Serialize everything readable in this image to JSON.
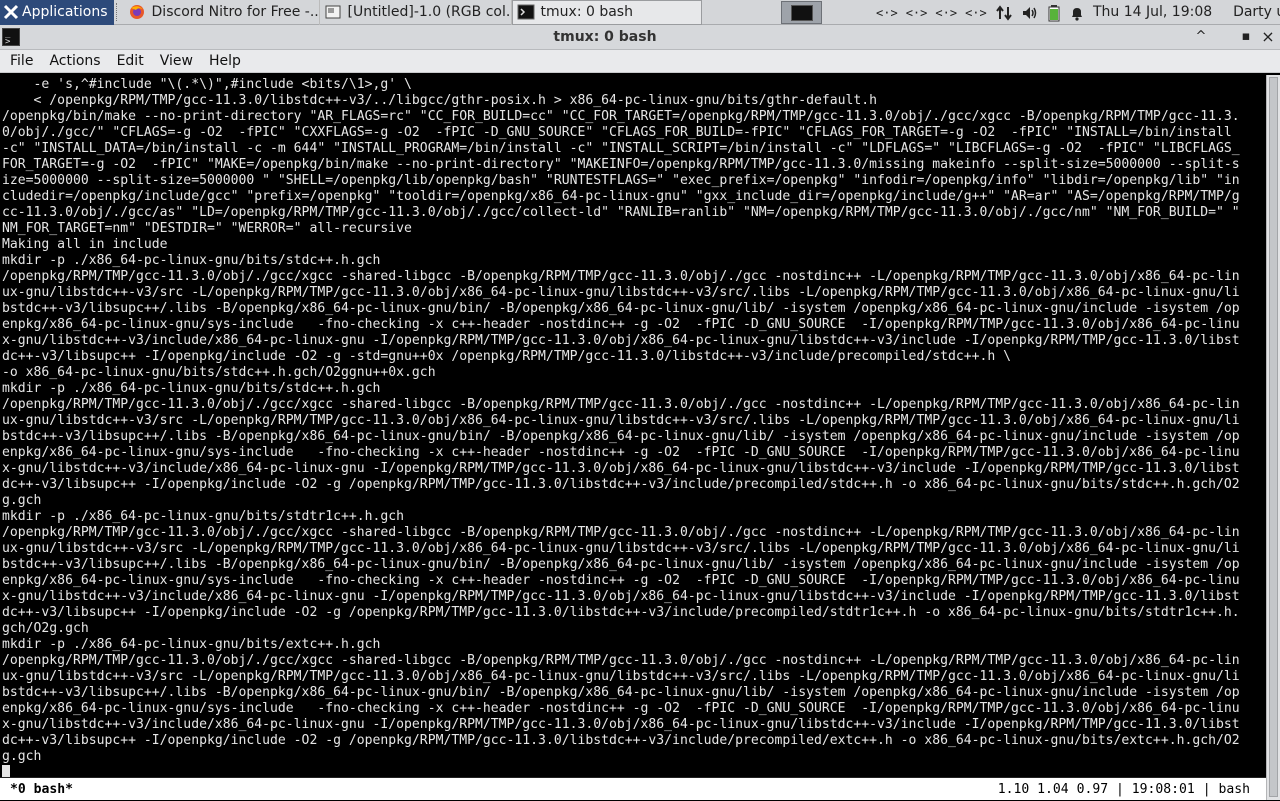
{
  "panel": {
    "applications_label": "Applications",
    "tasks": [
      {
        "label": "Discord Nitro for Free -...",
        "icon": "firefox-icon"
      },
      {
        "label": "[Untitled]-1.0 (RGB col...",
        "icon": "gimp-icon"
      },
      {
        "label": "tmux: 0 bash",
        "icon": "terminal-icon"
      }
    ],
    "tray_icons": [
      "network-icon",
      "network-icon",
      "network-icon",
      "network-icon",
      "transfer-icon",
      "volume-icon",
      "battery-icon",
      "bell-icon"
    ],
    "clock": "Thu 14 Jul, 19:08",
    "user": "Darty uwu"
  },
  "window": {
    "title": "tmux: 0 bash",
    "controls": {
      "minimize": "^",
      "maximize": "▪",
      "close": "×"
    }
  },
  "menubar": {
    "items": [
      "File",
      "Actions",
      "Edit",
      "View",
      "Help"
    ]
  },
  "terminal": {
    "lines": [
      "    -e 's,^#include \"\\(.*\\)\",#include <bits/\\1>,g' \\",
      "    < /openpkg/RPM/TMP/gcc-11.3.0/libstdc++-v3/../libgcc/gthr-posix.h > x86_64-pc-linux-gnu/bits/gthr-default.h",
      "/openpkg/bin/make --no-print-directory \"AR_FLAGS=rc\" \"CC_FOR_BUILD=cc\" \"CC_FOR_TARGET=/openpkg/RPM/TMP/gcc-11.3.0/obj/./gcc/xgcc -B/openpkg/RPM/TMP/gcc-11.3.",
      "0/obj/./gcc/\" \"CFLAGS=-g -O2  -fPIC\" \"CXXFLAGS=-g -O2  -fPIC -D_GNU_SOURCE\" \"CFLAGS_FOR_BUILD=-fPIC\" \"CFLAGS_FOR_TARGET=-g -O2  -fPIC\" \"INSTALL=/bin/install",
      "-c\" \"INSTALL_DATA=/bin/install -c -m 644\" \"INSTALL_PROGRAM=/bin/install -c\" \"INSTALL_SCRIPT=/bin/install -c\" \"LDFLAGS=\" \"LIBCFLAGS=-g -O2  -fPIC\" \"LIBCFLAGS_",
      "FOR_TARGET=-g -O2  -fPIC\" \"MAKE=/openpkg/bin/make --no-print-directory\" \"MAKEINFO=/openpkg/RPM/TMP/gcc-11.3.0/missing makeinfo --split-size=5000000 --split-s",
      "ize=5000000 --split-size=5000000 \" \"SHELL=/openpkg/lib/openpkg/bash\" \"RUNTESTFLAGS=\" \"exec_prefix=/openpkg\" \"infodir=/openpkg/info\" \"libdir=/openpkg/lib\" \"in",
      "cludedir=/openpkg/include/gcc\" \"prefix=/openpkg\" \"tooldir=/openpkg/x86_64-pc-linux-gnu\" \"gxx_include_dir=/openpkg/include/g++\" \"AR=ar\" \"AS=/openpkg/RPM/TMP/g",
      "cc-11.3.0/obj/./gcc/as\" \"LD=/openpkg/RPM/TMP/gcc-11.3.0/obj/./gcc/collect-ld\" \"RANLIB=ranlib\" \"NM=/openpkg/RPM/TMP/gcc-11.3.0/obj/./gcc/nm\" \"NM_FOR_BUILD=\" \"",
      "NM_FOR_TARGET=nm\" \"DESTDIR=\" \"WERROR=\" all-recursive",
      "Making all in include",
      "mkdir -p ./x86_64-pc-linux-gnu/bits/stdc++.h.gch",
      "/openpkg/RPM/TMP/gcc-11.3.0/obj/./gcc/xgcc -shared-libgcc -B/openpkg/RPM/TMP/gcc-11.3.0/obj/./gcc -nostdinc++ -L/openpkg/RPM/TMP/gcc-11.3.0/obj/x86_64-pc-lin",
      "ux-gnu/libstdc++-v3/src -L/openpkg/RPM/TMP/gcc-11.3.0/obj/x86_64-pc-linux-gnu/libstdc++-v3/src/.libs -L/openpkg/RPM/TMP/gcc-11.3.0/obj/x86_64-pc-linux-gnu/li",
      "bstdc++-v3/libsupc++/.libs -B/openpkg/x86_64-pc-linux-gnu/bin/ -B/openpkg/x86_64-pc-linux-gnu/lib/ -isystem /openpkg/x86_64-pc-linux-gnu/include -isystem /op",
      "enpkg/x86_64-pc-linux-gnu/sys-include   -fno-checking -x c++-header -nostdinc++ -g -O2  -fPIC -D_GNU_SOURCE  -I/openpkg/RPM/TMP/gcc-11.3.0/obj/x86_64-pc-linu",
      "x-gnu/libstdc++-v3/include/x86_64-pc-linux-gnu -I/openpkg/RPM/TMP/gcc-11.3.0/obj/x86_64-pc-linux-gnu/libstdc++-v3/include -I/openpkg/RPM/TMP/gcc-11.3.0/libst",
      "dc++-v3/libsupc++ -I/openpkg/include -O2 -g -std=gnu++0x /openpkg/RPM/TMP/gcc-11.3.0/libstdc++-v3/include/precompiled/stdc++.h \\",
      "-o x86_64-pc-linux-gnu/bits/stdc++.h.gch/O2ggnu++0x.gch",
      "mkdir -p ./x86_64-pc-linux-gnu/bits/stdc++.h.gch",
      "/openpkg/RPM/TMP/gcc-11.3.0/obj/./gcc/xgcc -shared-libgcc -B/openpkg/RPM/TMP/gcc-11.3.0/obj/./gcc -nostdinc++ -L/openpkg/RPM/TMP/gcc-11.3.0/obj/x86_64-pc-lin",
      "ux-gnu/libstdc++-v3/src -L/openpkg/RPM/TMP/gcc-11.3.0/obj/x86_64-pc-linux-gnu/libstdc++-v3/src/.libs -L/openpkg/RPM/TMP/gcc-11.3.0/obj/x86_64-pc-linux-gnu/li",
      "bstdc++-v3/libsupc++/.libs -B/openpkg/x86_64-pc-linux-gnu/bin/ -B/openpkg/x86_64-pc-linux-gnu/lib/ -isystem /openpkg/x86_64-pc-linux-gnu/include -isystem /op",
      "enpkg/x86_64-pc-linux-gnu/sys-include   -fno-checking -x c++-header -nostdinc++ -g -O2  -fPIC -D_GNU_SOURCE  -I/openpkg/RPM/TMP/gcc-11.3.0/obj/x86_64-pc-linu",
      "x-gnu/libstdc++-v3/include/x86_64-pc-linux-gnu -I/openpkg/RPM/TMP/gcc-11.3.0/obj/x86_64-pc-linux-gnu/libstdc++-v3/include -I/openpkg/RPM/TMP/gcc-11.3.0/libst",
      "dc++-v3/libsupc++ -I/openpkg/include -O2 -g /openpkg/RPM/TMP/gcc-11.3.0/libstdc++-v3/include/precompiled/stdc++.h -o x86_64-pc-linux-gnu/bits/stdc++.h.gch/O2",
      "g.gch",
      "mkdir -p ./x86_64-pc-linux-gnu/bits/stdtr1c++.h.gch",
      "/openpkg/RPM/TMP/gcc-11.3.0/obj/./gcc/xgcc -shared-libgcc -B/openpkg/RPM/TMP/gcc-11.3.0/obj/./gcc -nostdinc++ -L/openpkg/RPM/TMP/gcc-11.3.0/obj/x86_64-pc-lin",
      "ux-gnu/libstdc++-v3/src -L/openpkg/RPM/TMP/gcc-11.3.0/obj/x86_64-pc-linux-gnu/libstdc++-v3/src/.libs -L/openpkg/RPM/TMP/gcc-11.3.0/obj/x86_64-pc-linux-gnu/li",
      "bstdc++-v3/libsupc++/.libs -B/openpkg/x86_64-pc-linux-gnu/bin/ -B/openpkg/x86_64-pc-linux-gnu/lib/ -isystem /openpkg/x86_64-pc-linux-gnu/include -isystem /op",
      "enpkg/x86_64-pc-linux-gnu/sys-include   -fno-checking -x c++-header -nostdinc++ -g -O2  -fPIC -D_GNU_SOURCE  -I/openpkg/RPM/TMP/gcc-11.3.0/obj/x86_64-pc-linu",
      "x-gnu/libstdc++-v3/include/x86_64-pc-linux-gnu -I/openpkg/RPM/TMP/gcc-11.3.0/obj/x86_64-pc-linux-gnu/libstdc++-v3/include -I/openpkg/RPM/TMP/gcc-11.3.0/libst",
      "dc++-v3/libsupc++ -I/openpkg/include -O2 -g /openpkg/RPM/TMP/gcc-11.3.0/libstdc++-v3/include/precompiled/stdtr1c++.h -o x86_64-pc-linux-gnu/bits/stdtr1c++.h.",
      "gch/O2g.gch",
      "mkdir -p ./x86_64-pc-linux-gnu/bits/extc++.h.gch",
      "/openpkg/RPM/TMP/gcc-11.3.0/obj/./gcc/xgcc -shared-libgcc -B/openpkg/RPM/TMP/gcc-11.3.0/obj/./gcc -nostdinc++ -L/openpkg/RPM/TMP/gcc-11.3.0/obj/x86_64-pc-lin",
      "ux-gnu/libstdc++-v3/src -L/openpkg/RPM/TMP/gcc-11.3.0/obj/x86_64-pc-linux-gnu/libstdc++-v3/src/.libs -L/openpkg/RPM/TMP/gcc-11.3.0/obj/x86_64-pc-linux-gnu/li",
      "bstdc++-v3/libsupc++/.libs -B/openpkg/x86_64-pc-linux-gnu/bin/ -B/openpkg/x86_64-pc-linux-gnu/lib/ -isystem /openpkg/x86_64-pc-linux-gnu/include -isystem /op",
      "enpkg/x86_64-pc-linux-gnu/sys-include   -fno-checking -x c++-header -nostdinc++ -g -O2  -fPIC -D_GNU_SOURCE  -I/openpkg/RPM/TMP/gcc-11.3.0/obj/x86_64-pc-linu",
      "x-gnu/libstdc++-v3/include/x86_64-pc-linux-gnu -I/openpkg/RPM/TMP/gcc-11.3.0/obj/x86_64-pc-linux-gnu/libstdc++-v3/include -I/openpkg/RPM/TMP/gcc-11.3.0/libst",
      "dc++-v3/libsupc++ -I/openpkg/include -O2 -g /openpkg/RPM/TMP/gcc-11.3.0/libstdc++-v3/include/precompiled/extc++.h -o x86_64-pc-linux-gnu/bits/extc++.h.gch/O2",
      "g.gch"
    ]
  },
  "tmux": {
    "window_label": "*0 bash*",
    "status_right": "1.10 1.04 0.97 | 19:08:01 | bash"
  },
  "colors": {
    "panel_bg": "#d4d6d9",
    "terminal_bg": "#000000",
    "terminal_fg": "#e6e6e6",
    "tmux_bar_bg": "#ffffff"
  }
}
